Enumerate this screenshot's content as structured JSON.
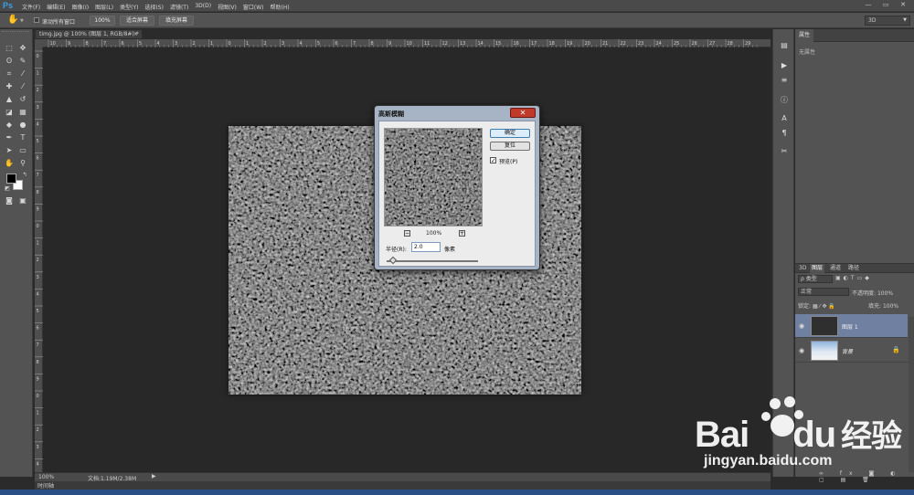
{
  "app": {
    "logo": "Ps",
    "menu": [
      "文件(F)",
      "编辑(E)",
      "图像(I)",
      "图层(L)",
      "类型(Y)",
      "选择(S)",
      "滤镜(T)",
      "3D(D)",
      "视图(V)",
      "窗口(W)",
      "帮助(H)"
    ],
    "window_buttons": [
      "—",
      "▭",
      "✕"
    ]
  },
  "options_bar": {
    "scroll_all_windows": "滚动所有窗口",
    "zoom_100": "100%",
    "fit_screen": "适合屏幕",
    "fill_screen": "填充屏幕",
    "workspace": "3D"
  },
  "document": {
    "tab_title": "timg.jpg @ 100% (图层 1, RGB/8#) *",
    "ruler_h": [
      "10",
      "9",
      "8",
      "7",
      "6",
      "5",
      "4",
      "3",
      "2",
      "1",
      "0",
      "1",
      "2",
      "3",
      "4",
      "5",
      "6",
      "7",
      "8",
      "9",
      "10",
      "11",
      "12",
      "13",
      "14",
      "15",
      "16",
      "17",
      "18",
      "19",
      "20",
      "21",
      "22",
      "23",
      "24",
      "25",
      "26",
      "27",
      "28",
      "29"
    ],
    "ruler_v": [
      "0",
      "1",
      "2",
      "3",
      "4",
      "5",
      "6",
      "7",
      "8",
      "9",
      "0",
      "1",
      "2",
      "3",
      "4",
      "5",
      "6",
      "7",
      "8",
      "9",
      "0",
      "1",
      "2",
      "3",
      "4"
    ]
  },
  "status": {
    "zoom": "100%",
    "doc_info": "文档:1.19M/2.38M",
    "timeline_tab": "时间轴"
  },
  "properties_panel": {
    "tab": "属性",
    "empty_text": "无属性"
  },
  "layers_panel": {
    "tabs": [
      "3D",
      "图层",
      "通道",
      "路径"
    ],
    "filter_kind": "ρ 类型",
    "blend_mode": "正常",
    "opacity_label": "不透明度:",
    "opacity_value": "100%",
    "lock_label": "锁定:",
    "fill_label": "填充:",
    "fill_value": "100%",
    "layers": [
      {
        "name": "图层 1",
        "selected": true
      },
      {
        "name": "背景",
        "selected": false
      }
    ]
  },
  "dialog": {
    "title": "高斯模糊",
    "ok": "确定",
    "reset": "复位",
    "preview_label": "预览(P)",
    "preview_checked": true,
    "zoom_value": "100%",
    "radius_label": "半径(R):",
    "radius_value": "2.0",
    "radius_unit": "像素"
  },
  "watermark": {
    "brand": "Bai",
    "brand2": "du",
    "suffix": "经验",
    "url": "jingyan.baidu.com"
  }
}
